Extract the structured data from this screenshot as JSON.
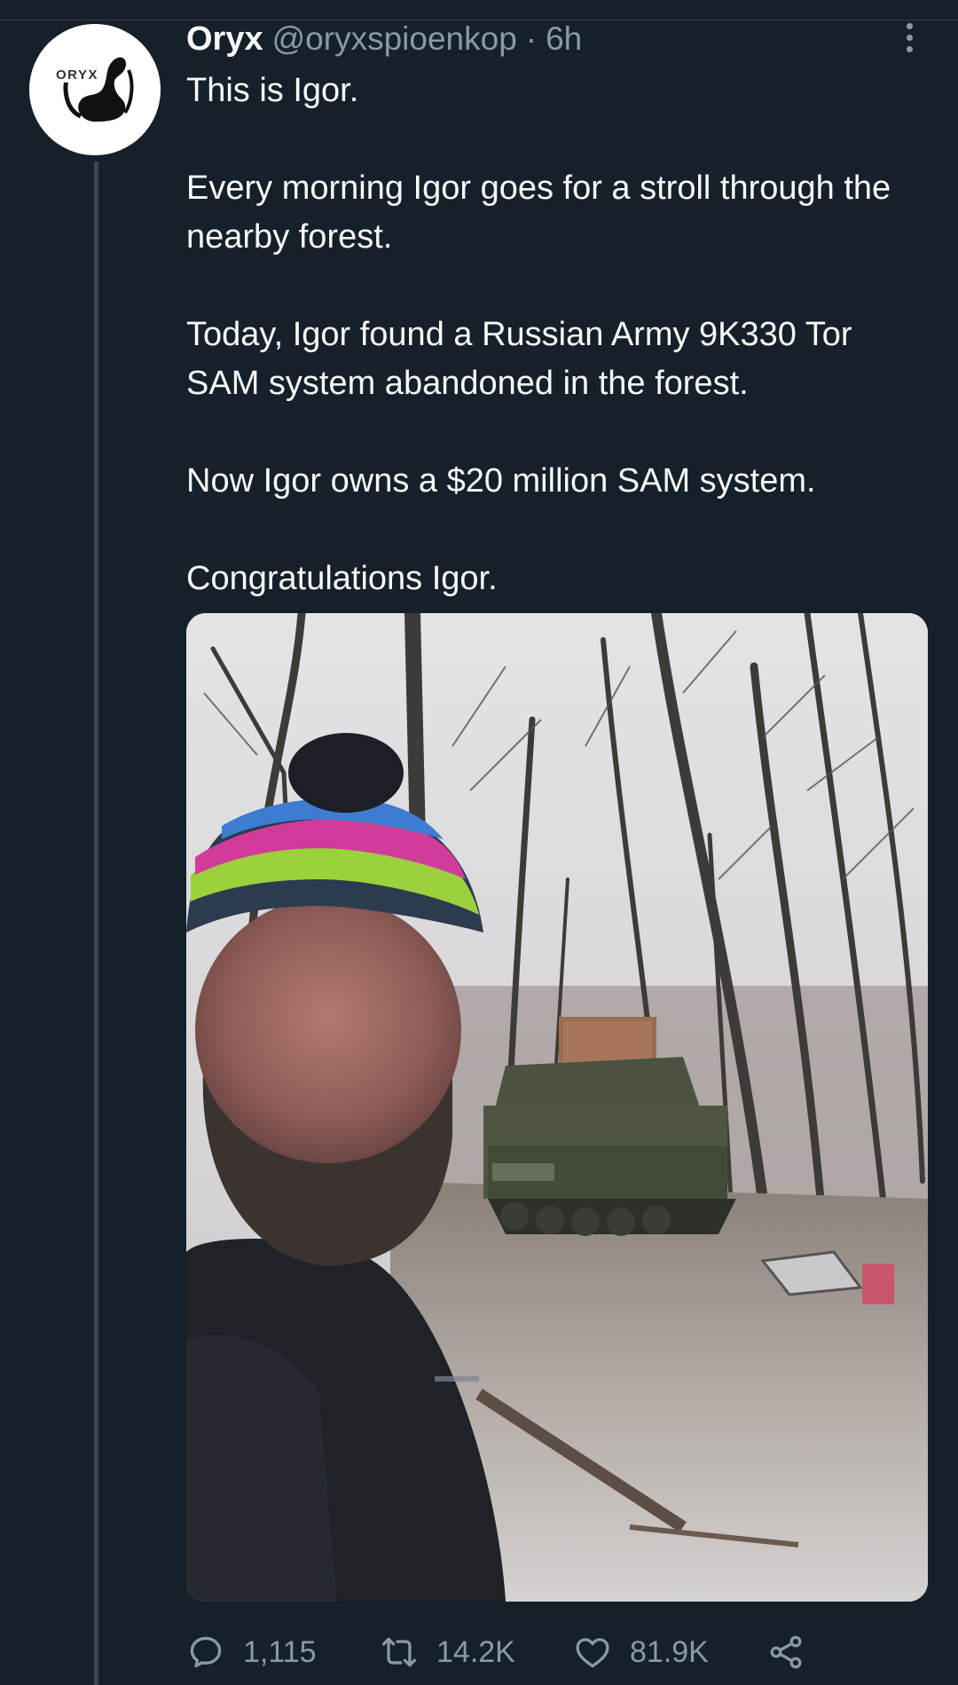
{
  "tweet": {
    "author": {
      "name": "Oryx",
      "handle": "@oryxspioenkop",
      "avatar_logo_text": "ORYX"
    },
    "separator": "·",
    "time": "6h",
    "paragraphs": [
      "This is Igor.",
      "Every morning Igor goes for a stroll through the nearby forest.",
      "Today, Igor found a Russian Army 9K330 Tor SAM system abandoned in the forest.",
      "Now Igor owns a $20 million SAM system.",
      "Congratulations Igor."
    ],
    "media_alt": "photo",
    "actions": {
      "reply": {
        "icon": "reply-icon",
        "count": "1,115"
      },
      "retweet": {
        "icon": "retweet-icon",
        "count": "14.2K"
      },
      "like": {
        "icon": "heart-icon",
        "count": "81.9K"
      },
      "share": {
        "icon": "share-icon"
      }
    }
  },
  "colors": {
    "background": "#15202b",
    "text_primary": "#f7f9f9",
    "text_secondary": "#8b98a5",
    "thread_line": "#3a4654"
  }
}
